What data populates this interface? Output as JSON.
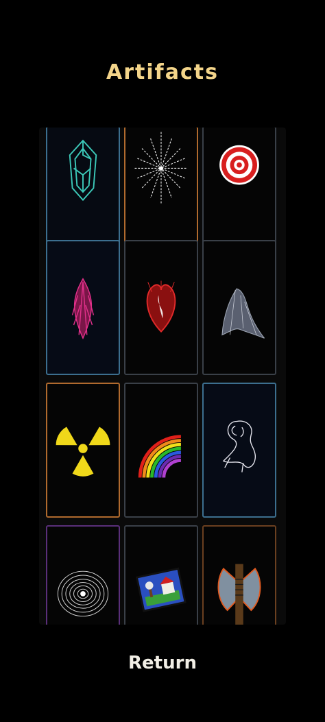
{
  "screen": {
    "title": "Artifacts",
    "return_label": "Return"
  },
  "artifacts": [
    {
      "icon": "crystal-shard-icon",
      "border": "#3c6f8f",
      "bg": "#060a12"
    },
    {
      "icon": "starburst-icon",
      "border": "#b06a2e",
      "bg": "#050505"
    },
    {
      "icon": "target-icon",
      "border": "#3a4048",
      "bg": "#050505"
    },
    {
      "icon": "pink-flame-icon",
      "border": "#3c6f8f",
      "bg": "#060b16"
    },
    {
      "icon": "bleeding-heart-icon",
      "border": "#3a4048",
      "bg": "#050505"
    },
    {
      "icon": "ghost-wisp-icon",
      "border": "#3a4048",
      "bg": "#050505"
    },
    {
      "icon": "radiation-icon",
      "border": "#b06a2e",
      "bg": "#050505"
    },
    {
      "icon": "rainbow-icon",
      "border": "#3a4048",
      "bg": "#050505"
    },
    {
      "icon": "spirit-icon",
      "border": "#3c6f8f",
      "bg": "#060b16"
    },
    {
      "icon": "vortex-icon",
      "border": "#5a2f7a",
      "bg": "#050505"
    },
    {
      "icon": "postcard-icon",
      "border": "#3a4048",
      "bg": "#050505"
    },
    {
      "icon": "battle-axe-icon",
      "border": "#6b4020",
      "bg": "#050505"
    }
  ],
  "colors": {
    "title": "#f4d58a",
    "return": "#f2efe6",
    "background": "#000000"
  }
}
